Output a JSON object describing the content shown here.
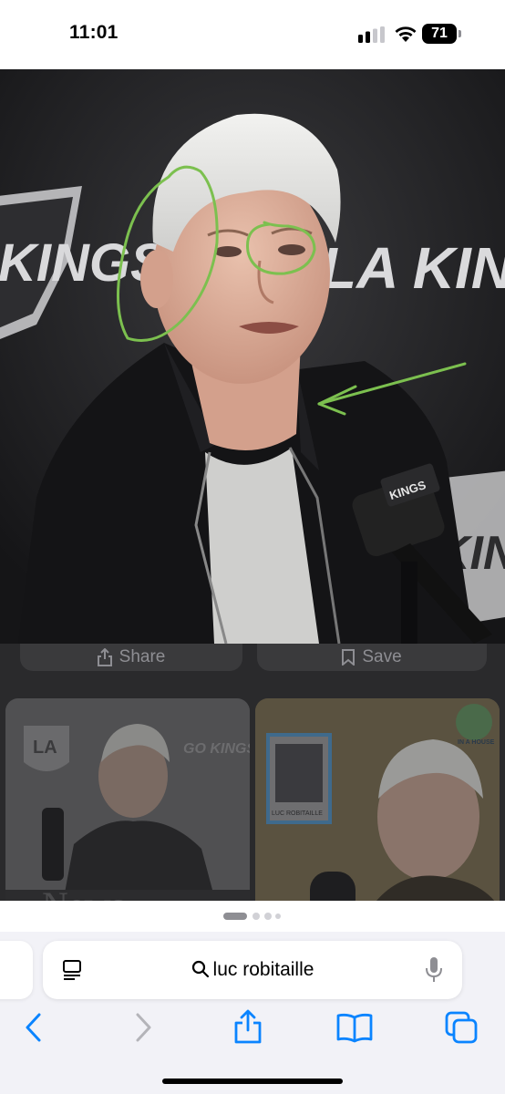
{
  "status_bar": {
    "time": "11:01",
    "battery_level": "71"
  },
  "photo": {
    "backdrop_text_left": "KINGS",
    "backdrop_text_right": "LA KINGS",
    "backdrop_text_lower": "KINGS",
    "mic_flag_text": "KINGS",
    "annotation_color": "#7cc04f"
  },
  "actions": {
    "share_label": "Share",
    "save_label": "Save"
  },
  "thumbnails": [
    {
      "logo_text": "LA",
      "side_text": "GO KINGS GO",
      "bottom_text": "News"
    },
    {
      "card_text": "LUC ROBITAILLE",
      "badge_text": "IN A HOUSE"
    }
  ],
  "page_indicator": {
    "count": 4,
    "active": 0
  },
  "address_bar": {
    "query": "luc robitaille"
  },
  "colors": {
    "accent": "#0a84ff",
    "disabled": "#b4b4b9"
  },
  "icons": [
    "reader-icon",
    "search-icon",
    "microphone-icon",
    "back-icon",
    "forward-icon",
    "share-icon",
    "bookmarks-icon",
    "tabs-icon"
  ]
}
